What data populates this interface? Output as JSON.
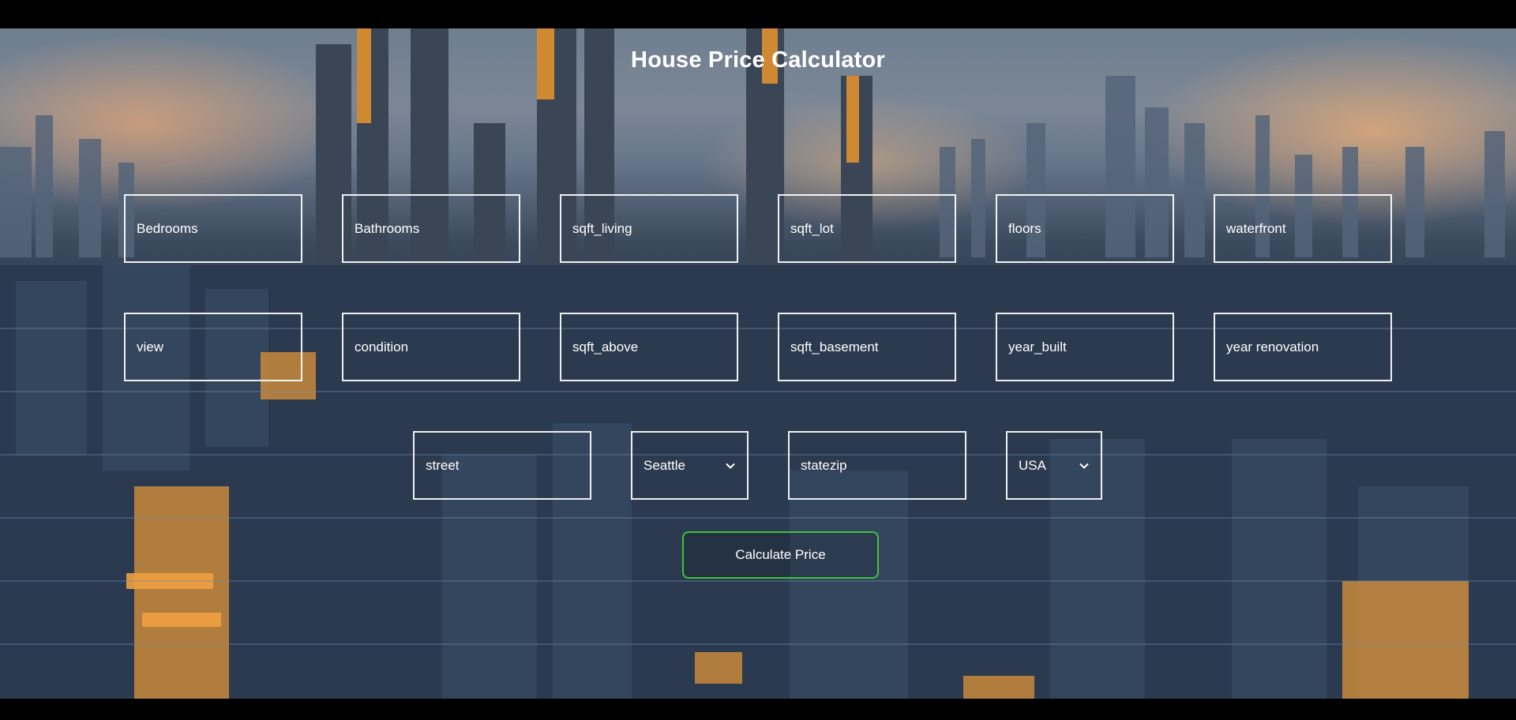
{
  "title": "House Price Calculator",
  "fields": {
    "bedrooms": "Bedrooms",
    "bathrooms": "Bathrooms",
    "sqft_living": "sqft_living",
    "sqft_lot": "sqft_lot",
    "floors": "floors",
    "waterfront": "waterfront",
    "view": "view",
    "condition": "condition",
    "sqft_above": "sqft_above",
    "sqft_basement": "sqft_basement",
    "year_built": "year_built",
    "year_renovation": "year renovation",
    "street": "street",
    "statezip": "statezip"
  },
  "city_select": {
    "value": "Seattle",
    "icon": "chevron-down-icon"
  },
  "country_select": {
    "value": "USA",
    "icon": "chevron-down-icon"
  },
  "button": {
    "label": "Calculate Price",
    "border_color": "#3cc43c"
  },
  "colors": {
    "text": "#ffffff",
    "field_border": "#ffffff",
    "page_background": "#000000"
  }
}
